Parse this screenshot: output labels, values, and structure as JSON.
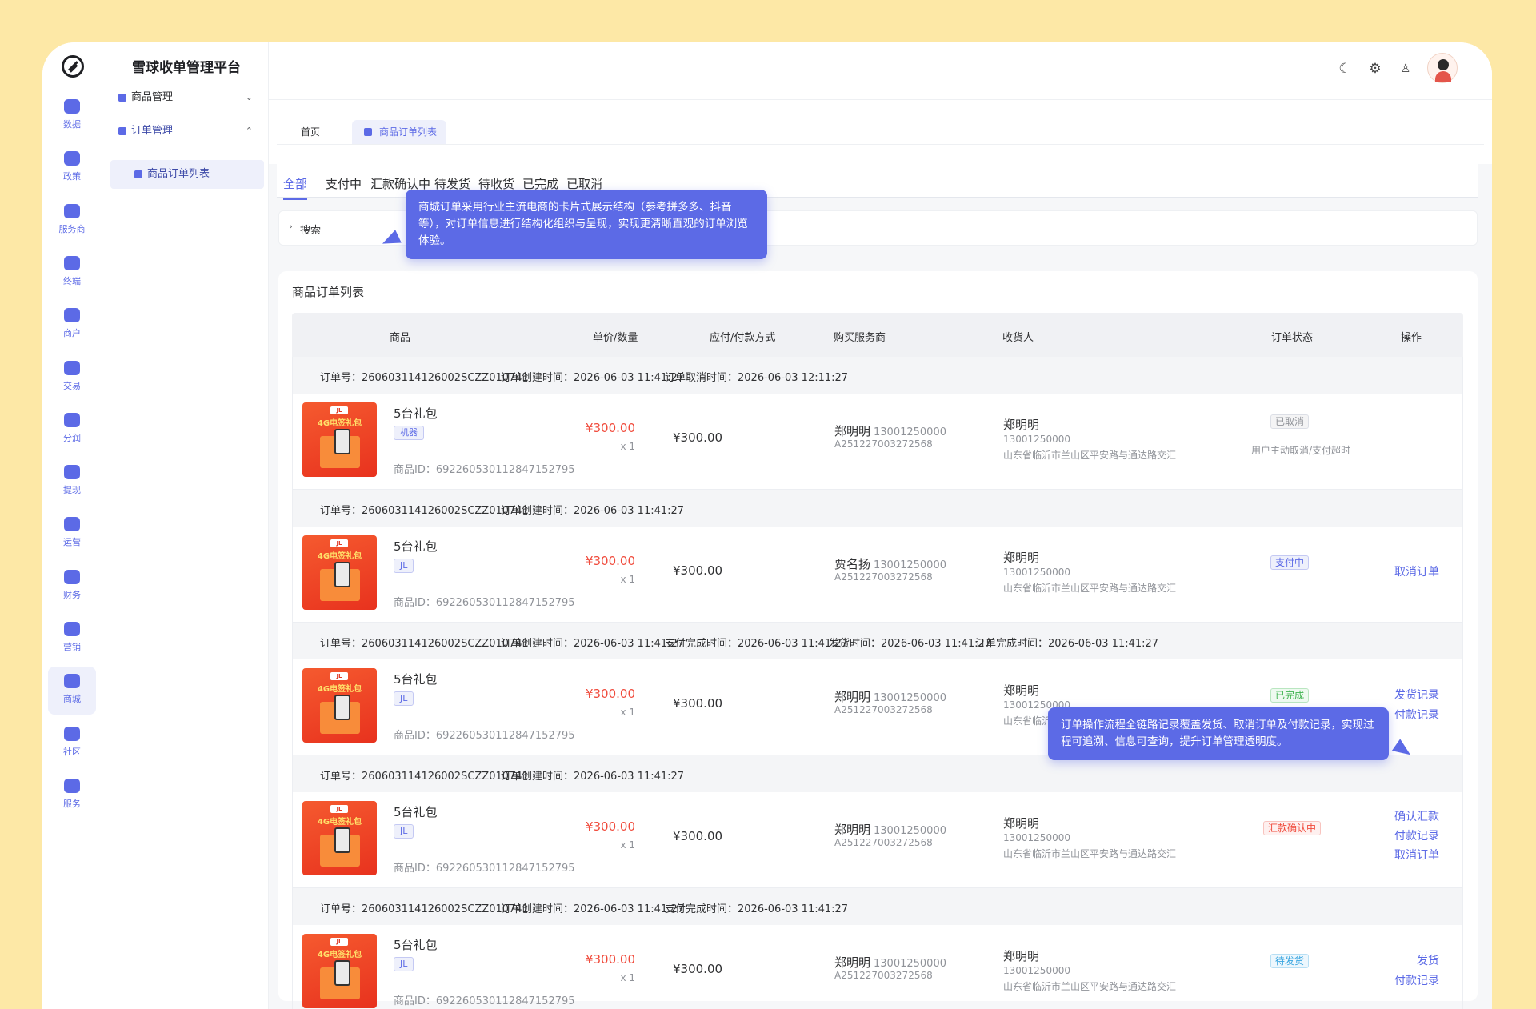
{
  "app": {
    "title": "雪球收单管理平台"
  },
  "rail": [
    {
      "label": "数据",
      "icon": "bar-chart-icon"
    },
    {
      "label": "政策",
      "icon": "grid-icon"
    },
    {
      "label": "服务商",
      "icon": "user-heart-icon"
    },
    {
      "label": "终端",
      "icon": "terminal-icon"
    },
    {
      "label": "商户",
      "icon": "store-icon"
    },
    {
      "label": "交易",
      "icon": "transaction-icon"
    },
    {
      "label": "分润",
      "icon": "money-bag-icon"
    },
    {
      "label": "提现",
      "icon": "wallet-icon"
    },
    {
      "label": "运营",
      "icon": "monitor-icon"
    },
    {
      "label": "财务",
      "icon": "shield-coin-icon"
    },
    {
      "label": "营销",
      "icon": "gift-icon"
    },
    {
      "label": "商城",
      "icon": "shop-bag-icon"
    },
    {
      "label": "社区",
      "icon": "chat-icon"
    },
    {
      "label": "服务",
      "icon": "hand-heart-icon"
    }
  ],
  "submenu": {
    "product_mgmt": "商品管理",
    "order_mgmt": "订单管理",
    "order_list": "商品订单列表"
  },
  "topbar_icons": [
    "moon-icon",
    "gear-icon",
    "shirt-icon",
    "avatar"
  ],
  "page_tabs": {
    "home": "首页",
    "current": "商品订单列表"
  },
  "filter_tabs": [
    "全部",
    "支付中",
    "汇款确认中",
    "待发货",
    "待收货",
    "已完成",
    "已取消"
  ],
  "search": {
    "label": "搜索"
  },
  "card_title": "商品订单列表",
  "columns": [
    "商品",
    "单价/数量",
    "应付/付款方式",
    "购买服务商",
    "收货人",
    "订单状态",
    "操作"
  ],
  "orders": [
    {
      "order_no": "订单号：260603114126002SCZZ010741",
      "meta": [
        "订单创建时间：2026-06-03 11:41:27",
        "订单取消时间：2026-06-03 12:11:27"
      ],
      "thumb_tag": "JL",
      "thumb_title": "4G电签礼包",
      "product": "5台礼包",
      "tag": "机器",
      "product_id": "商品ID：692260530112847152795",
      "price": "¥300.00",
      "qty": "x 1",
      "pay": "¥300.00",
      "buyer": "郑明明",
      "buyer_phone": "13001250000",
      "buyer_code": "A251227003272568",
      "recv_name": "郑明明",
      "recv_phone": "13001250000",
      "recv_addr": "山东省临沂市兰山区平安路与通达路交汇",
      "status": "已取消",
      "status_note": "用户主动取消/支付超时",
      "actions": []
    },
    {
      "order_no": "订单号：260603114126002SCZZ010741",
      "meta": [
        "订单创建时间：2026-06-03 11:41:27"
      ],
      "thumb_tag": "JL",
      "thumb_title": "4G电签礼包",
      "product": "5台礼包",
      "tag": "JL",
      "product_id": "商品ID：692260530112847152795",
      "price": "¥300.00",
      "qty": "x 1",
      "pay": "¥300.00",
      "buyer": "贾名扬",
      "buyer_phone": "13001250000",
      "buyer_code": "A251227003272568",
      "recv_name": "郑明明",
      "recv_phone": "13001250000",
      "recv_addr": "山东省临沂市兰山区平安路与通达路交汇",
      "status": "支付中",
      "status_note": "",
      "actions": [
        "取消订单"
      ]
    },
    {
      "order_no": "订单号：260603114126002SCZZ010741",
      "meta": [
        "订单创建时间：2026-06-03 11:41:27",
        "支付完成时间：2026-06-03 11:41:27",
        "发货时间：2026-06-03 11:41:27",
        "订单完成时间：2026-06-03 11:41:27"
      ],
      "thumb_tag": "JL",
      "thumb_title": "4G电签礼包",
      "product": "5台礼包",
      "tag": "JL",
      "product_id": "商品ID：692260530112847152795",
      "price": "¥300.00",
      "qty": "x 1",
      "pay": "¥300.00",
      "buyer": "郑明明",
      "buyer_phone": "13001250000",
      "buyer_code": "A251227003272568",
      "recv_name": "郑明明",
      "recv_phone": "13001250000",
      "recv_addr": "山东省临沂市兰山区平安路与通达路交汇",
      "status": "已完成",
      "status_note": "",
      "actions": [
        "发货记录",
        "付款记录"
      ]
    },
    {
      "order_no": "订单号：260603114126002SCZZ010741",
      "meta": [
        "订单创建时间：2026-06-03 11:41:27"
      ],
      "thumb_tag": "JL",
      "thumb_title": "4G电签礼包",
      "product": "5台礼包",
      "tag": "JL",
      "product_id": "商品ID：692260530112847152795",
      "price": "¥300.00",
      "qty": "x 1",
      "pay": "¥300.00",
      "buyer": "郑明明",
      "buyer_phone": "13001250000",
      "buyer_code": "A251227003272568",
      "recv_name": "郑明明",
      "recv_phone": "13001250000",
      "recv_addr": "山东省临沂市兰山区平安路与通达路交汇",
      "status": "汇款确认中",
      "status_note": "",
      "actions": [
        "确认汇款",
        "付款记录",
        "取消订单"
      ]
    },
    {
      "order_no": "订单号：260603114126002SCZZ010741",
      "meta": [
        "订单创建时间：2026-06-03 11:41:27",
        "支付完成时间：2026-06-03 11:41:27"
      ],
      "thumb_tag": "JL",
      "thumb_title": "4G电签礼包",
      "product": "5台礼包",
      "tag": "JL",
      "product_id": "商品ID：692260530112847152795",
      "price": "¥300.00",
      "qty": "x 1",
      "pay": "¥300.00",
      "buyer": "郑明明",
      "buyer_phone": "13001250000",
      "buyer_code": "A251227003272568",
      "recv_name": "郑明明",
      "recv_phone": "13001250000",
      "recv_addr": "山东省临沂市兰山区平安路与通达路交汇",
      "status": "待发货",
      "status_note": "",
      "actions": [
        "发货",
        "付款记录"
      ]
    }
  ],
  "status_colors": {
    "已取消": {
      "fg": "#909399",
      "bg": "#f4f4f5",
      "border": "#dcdfe6"
    },
    "支付中": {
      "fg": "#5c6ae6",
      "bg": "#eef0fb",
      "border": "#c4c9f3"
    },
    "已完成": {
      "fg": "#3fb34f",
      "bg": "#eefaf0",
      "border": "#b9e6c0"
    },
    "汇款确认中": {
      "fg": "#f04a3b",
      "bg": "#fef0ef",
      "border": "#f8c4bf"
    },
    "待发货": {
      "fg": "#3aa6e0",
      "bg": "#edf7fd",
      "border": "#b7dff4"
    }
  },
  "tooltips": {
    "card_style": "商城订单采用行业主流电商的卡片式展示结构（参考拼多多、抖音等），对订单信息进行结构化组织与呈现，实现更清晰直观的订单浏览体验。",
    "workflow": "订单操作流程全链路记录覆盖发货、取消订单及付款记录，实现过程可追溯、信息可查询，提升订单管理透明度。"
  },
  "accent": "#5c6ae6"
}
